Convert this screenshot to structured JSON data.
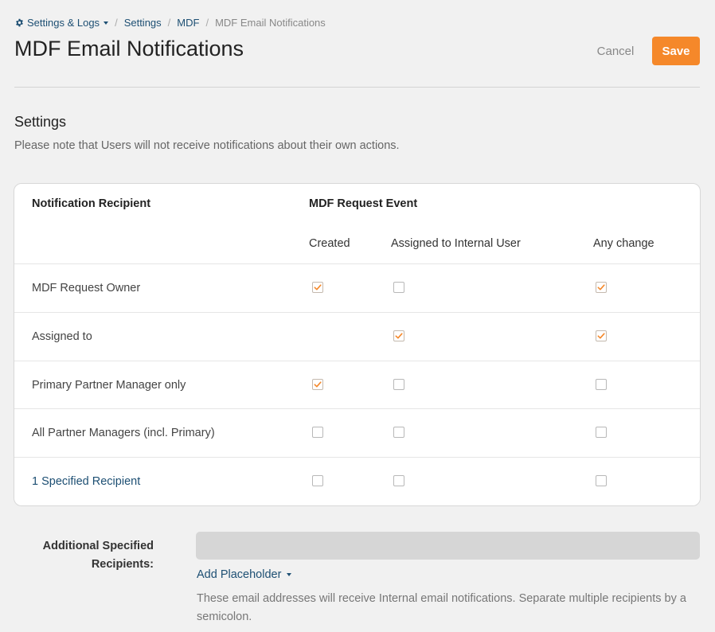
{
  "breadcrumb": {
    "root": "Settings & Logs",
    "items": [
      "Settings",
      "MDF"
    ],
    "current": "MDF Email Notifications"
  },
  "page_title": "MDF Email Notifications",
  "actions": {
    "cancel": "Cancel",
    "save": "Save"
  },
  "settings": {
    "title": "Settings",
    "note": "Please note that Users will not receive notifications about their own actions."
  },
  "table": {
    "recipient_header": "Notification Recipient",
    "event_header": "MDF Request Event",
    "columns": [
      "Created",
      "Assigned to Internal User",
      "Any change"
    ],
    "rows": [
      {
        "label": "MDF Request Owner",
        "link": false,
        "checks": [
          true,
          false,
          true
        ]
      },
      {
        "label": "Assigned to",
        "link": false,
        "checks": [
          null,
          true,
          true
        ]
      },
      {
        "label": "Primary Partner Manager only",
        "link": false,
        "checks": [
          true,
          false,
          false
        ]
      },
      {
        "label": "All Partner Managers (incl. Primary)",
        "link": false,
        "checks": [
          false,
          false,
          false
        ]
      },
      {
        "label": "1 Specified Recipient",
        "link": true,
        "checks": [
          false,
          false,
          false
        ]
      }
    ]
  },
  "additional": {
    "label_line1": "Additional Specified",
    "label_line2": "Recipients:",
    "value": "",
    "add_placeholder": "Add Placeholder",
    "help": "These email addresses will receive Internal email notifications. Separate multiple recipients by a semicolon."
  },
  "colors": {
    "accent": "#f5882a",
    "link": "#1d4f73",
    "background": "#f1f1f1"
  }
}
